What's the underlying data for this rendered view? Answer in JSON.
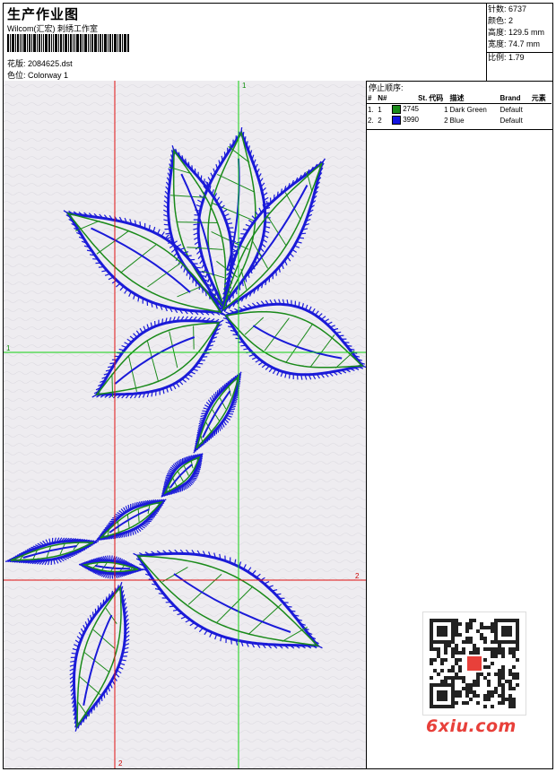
{
  "header": {
    "title": "生产作业图",
    "company": "Wilcom(汇宏) 刺绣工作室",
    "design_label": "花版:",
    "design_value": "2084625.dst",
    "colorway_label": "色位:",
    "colorway_value": "Colorway 1"
  },
  "stats": [
    {
      "label": "针数:",
      "value": "6737"
    },
    {
      "label": "颜色:",
      "value": "2"
    },
    {
      "label": "高度:",
      "value": "129.5 mm"
    },
    {
      "label": "宽度:",
      "value": "74.7 mm"
    },
    {
      "label": "比例:",
      "value": "1.79"
    }
  ],
  "stop_sequence": {
    "title": "停止顺序:",
    "columns": [
      "#",
      "N#",
      "St.",
      "代码",
      "描述",
      "Brand",
      "元素"
    ],
    "rows": [
      {
        "index": "1.",
        "n": "1",
        "stitches": "2745",
        "code": "1",
        "description": "Dark Green",
        "brand": "Default",
        "color": "#1a8a1a"
      },
      {
        "index": "2.",
        "n": "2",
        "stitches": "3990",
        "code": "2",
        "description": "Blue",
        "brand": "Default",
        "color": "#1414e0"
      }
    ]
  },
  "axes": {
    "top_label": "1",
    "left_label": "1",
    "right_label": "2",
    "bottom_label": "2"
  },
  "colors": {
    "green_thread": "#1a8a1a",
    "blue_thread": "#1a1ad8",
    "guide_red": "#e01010",
    "guide_green": "#10d010"
  },
  "watermark": "6xiu.com"
}
